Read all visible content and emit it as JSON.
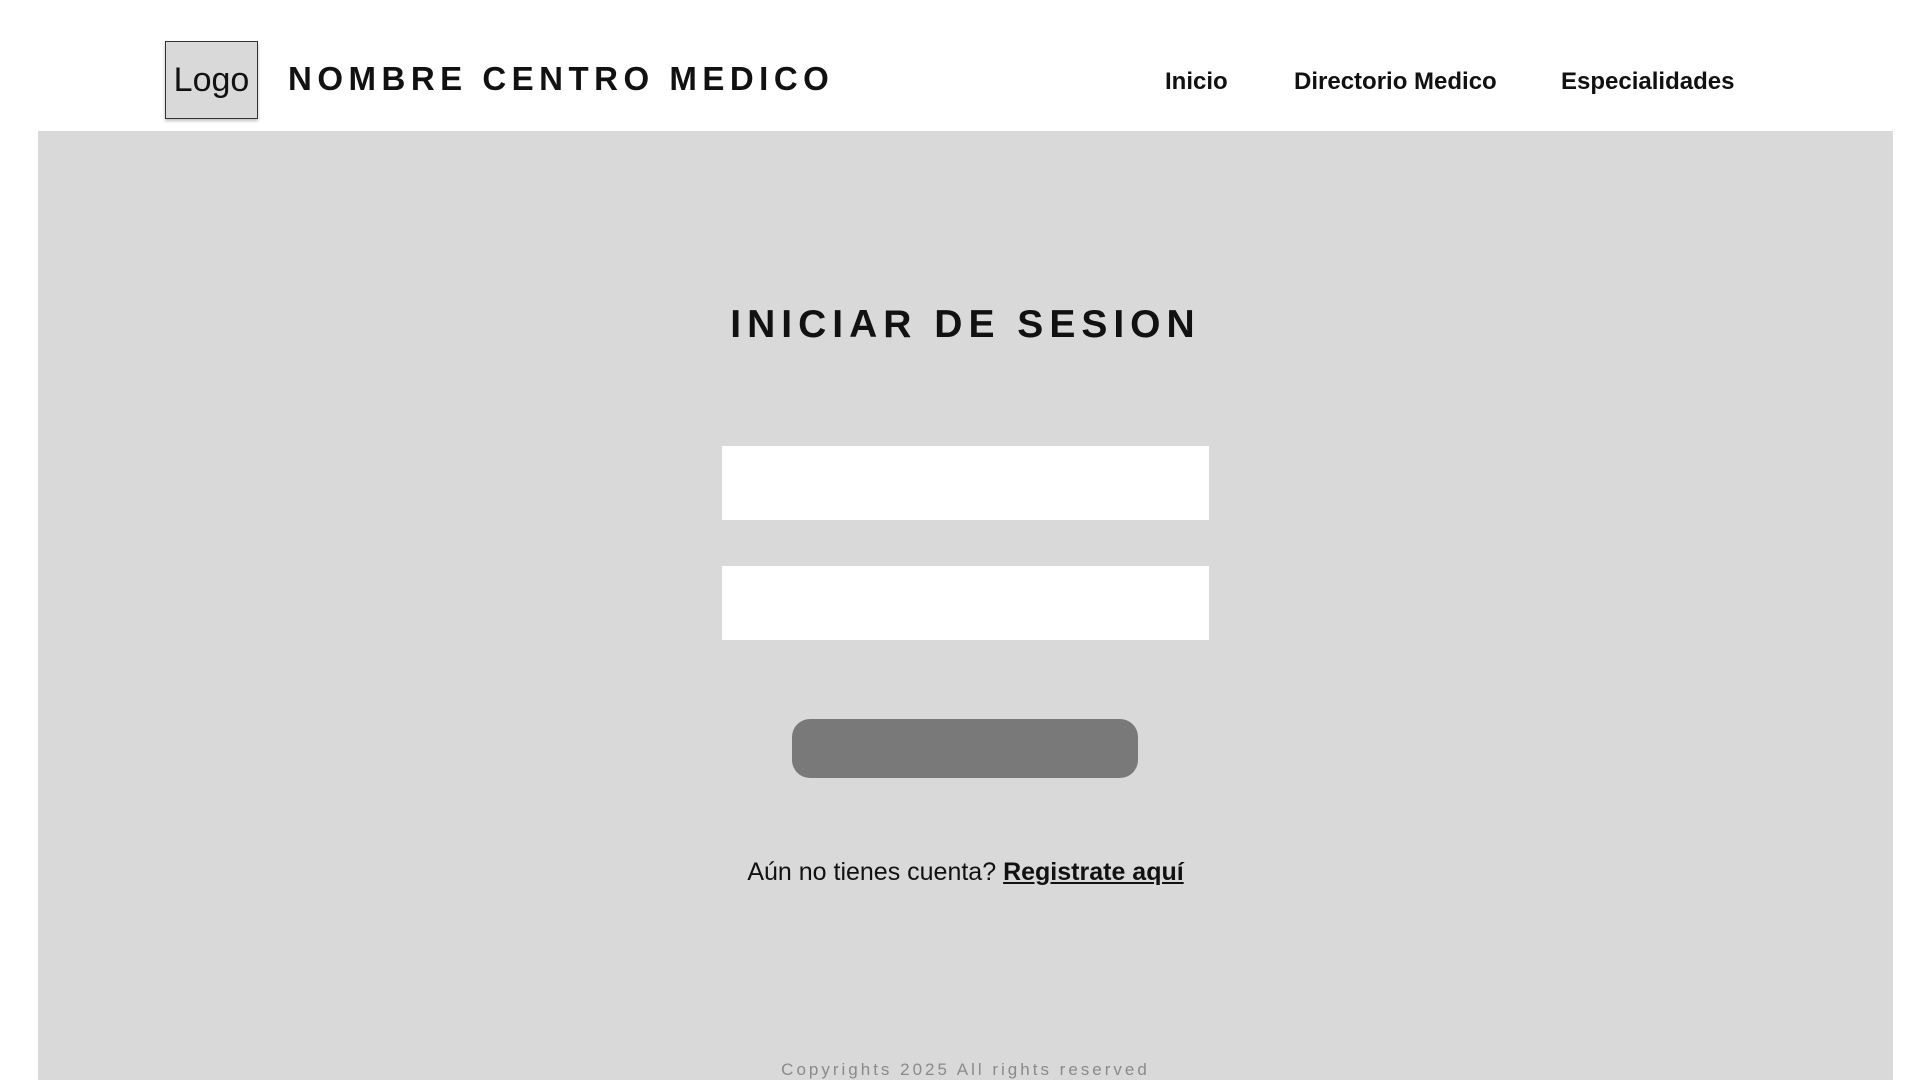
{
  "header": {
    "logo_text": "Logo",
    "site_title": "NOMBRE CENTRO MEDICO",
    "nav": {
      "inicio": "Inicio",
      "directorio": "Directorio Medico",
      "especialidades": "Especialidades"
    }
  },
  "login": {
    "title": "INICIAR DE SESION",
    "username": {
      "value": "",
      "placeholder": ""
    },
    "password": {
      "value": "",
      "placeholder": ""
    },
    "submit_label": "",
    "register_prompt": "Aún no tienes cuenta?",
    "register_link": "Registrate aquí"
  },
  "footer": {
    "copyright": "Copyrights 2025 All rights reserved"
  },
  "colors": {
    "page_background": "#ffffff",
    "content_background": "#d9d9d9",
    "button_background": "#797979",
    "footer_text": "#8a8a8a"
  }
}
